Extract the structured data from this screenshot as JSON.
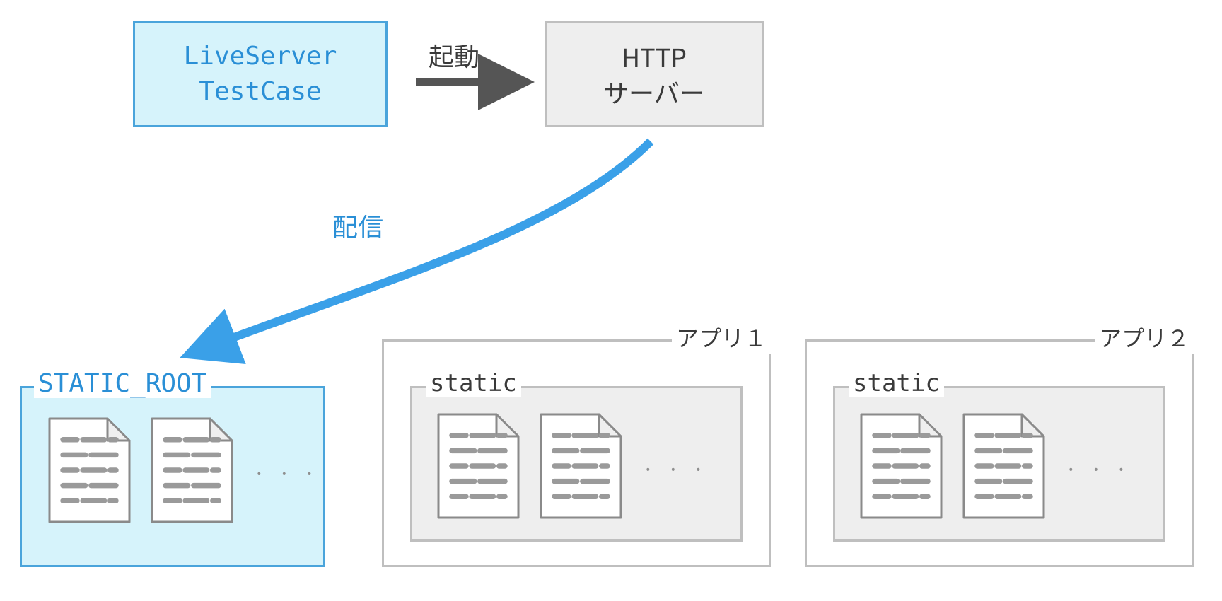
{
  "testcase": {
    "line1": "LiveServer",
    "line2": "TestCase"
  },
  "http_server": {
    "line1": "HTTP",
    "line2": "サーバー"
  },
  "arrows": {
    "launch": "起動",
    "deliver": "配信"
  },
  "static_root": {
    "label": "STATIC_ROOT",
    "ellipsis": "· · ·"
  },
  "apps": [
    {
      "label": "アプリ１",
      "static_label": "static",
      "ellipsis": "· · ·"
    },
    {
      "label": "アプリ２",
      "static_label": "static",
      "ellipsis": "· · ·"
    }
  ],
  "colors": {
    "accent": "#2a8fd6",
    "accent_border": "#4aa4db",
    "accent_fill": "#d6f3fb",
    "gray_border": "#bfbfbf",
    "gray_fill": "#eeeeee",
    "text": "#3a3a3a",
    "arrow_dark": "#555555"
  }
}
